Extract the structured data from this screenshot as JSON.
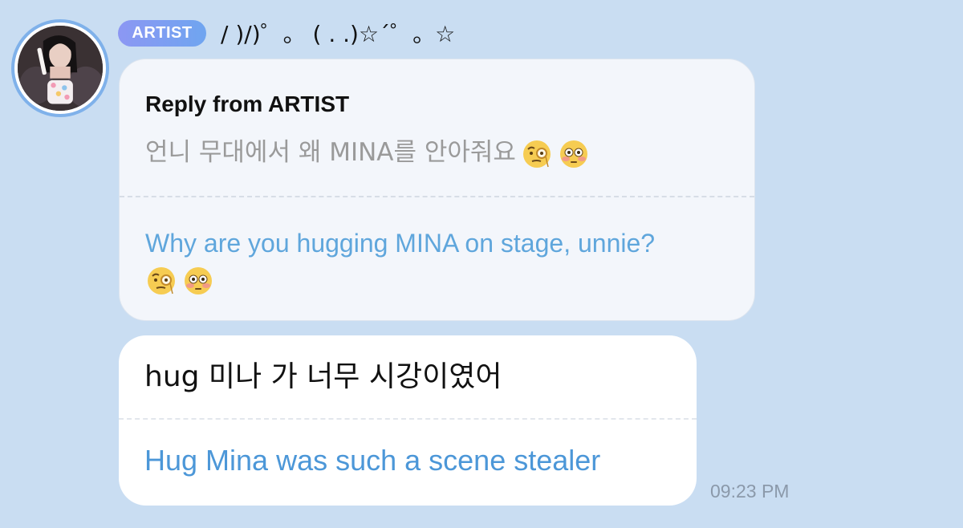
{
  "message": {
    "badge": "ARTIST",
    "sender_name": "/ )/)゜。 ( . .)☆´゜。☆",
    "avatar_icon": "artist-profile-photo",
    "reply": {
      "title": "Reply from ARTIST",
      "original_text": "언니 무대에서 왜 MINA를 안아줘요",
      "translated_text": "Why are you hugging MINA on stage, unnie?",
      "emojis": [
        "monocle-face-icon",
        "flushed-face-icon"
      ]
    },
    "body": {
      "original_text": "hug 미나 가 너무 시강이였어",
      "translated_text": "Hug Mina was such a scene stealer"
    },
    "timestamp": "09:23 PM"
  },
  "colors": {
    "background": "#c9ddf2",
    "badge_gradient_start": "#8c97f3",
    "badge_gradient_end": "#6fa5f0",
    "translation_text": "#4c97d8",
    "reply_bubble": "#f3f6fb",
    "bubble": "#ffffff"
  }
}
